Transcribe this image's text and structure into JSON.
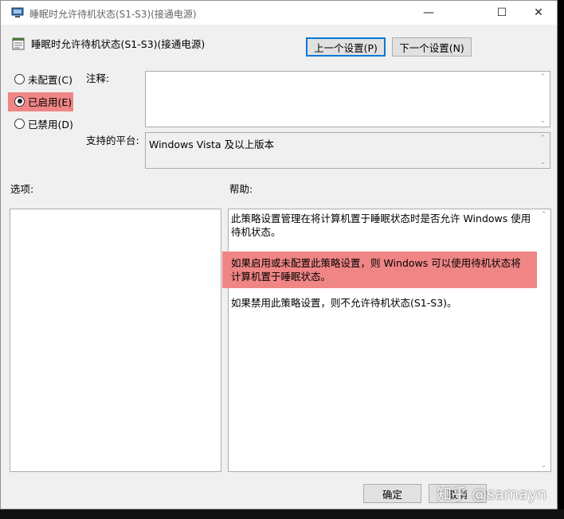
{
  "window": {
    "title": "睡眠时允许待机状态(S1-S3)(接通电源)",
    "controls": {
      "minimize": "—",
      "maximize": "☐",
      "close": "✕"
    }
  },
  "header": {
    "policy_name": "睡眠时允许待机状态(S1-S3)(接通电源)",
    "prev_label": "上一个设置(P)",
    "next_label": "下一个设置(N)"
  },
  "state": {
    "options": [
      {
        "label": "未配置(C)",
        "selected": false
      },
      {
        "label": "已启用(E)",
        "selected": true
      },
      {
        "label": "已禁用(D)",
        "selected": false
      }
    ]
  },
  "comment": {
    "label": "注释:",
    "value": ""
  },
  "platform": {
    "label": "支持的平台:",
    "value": "Windows Vista 及以上版本"
  },
  "options_label": "选项:",
  "help": {
    "label": "帮助:",
    "paragraphs": [
      "此策略设置管理在将计算机置于睡眠状态时是否允许 Windows 使用待机状态。",
      "如果启用或未配置此策略设置，则 Windows 可以使用待机状态将计算机置于睡眠状态。",
      "如果禁用此策略设置，则不允许待机状态(S1-S3)。"
    ]
  },
  "footer": {
    "ok_label": "确定",
    "cancel_label": "取消"
  },
  "watermark": "知乎 @samayn",
  "colors": {
    "highlight": "#f08585",
    "focus_border": "#0078d7"
  },
  "icons": [
    "app-icon",
    "policy-icon",
    "scroll-up-icon",
    "scroll-down-icon"
  ]
}
